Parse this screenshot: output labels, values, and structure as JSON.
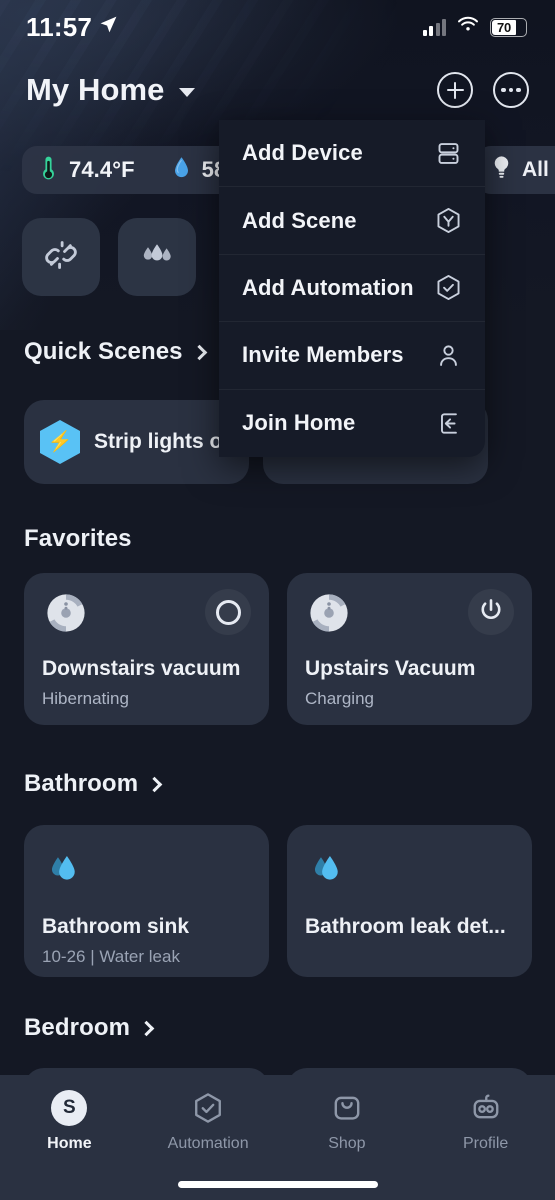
{
  "status_bar": {
    "time": "11:57",
    "location_icon": "location-arrow-icon",
    "cellular_icon": "cellular-bars-icon",
    "wifi_icon": "wifi-icon",
    "battery_percent": "70"
  },
  "header": {
    "title": "My Home",
    "dropdown_caret_icon": "chevron-down-icon",
    "add_button_icon": "plus-circle-icon",
    "more_button_icon": "more-circle-icon"
  },
  "sensor_pill": {
    "temperature": "74.4°F",
    "temperature_icon": "thermometer-icon",
    "temperature_color": "#35d39a",
    "humidity": "58",
    "humidity_icon": "water-drop-icon",
    "humidity_color": "#4aa3e8"
  },
  "quick_buttons": [
    {
      "name": "broken-link-icon",
      "label": ""
    },
    {
      "name": "water-drops-icon",
      "label": ""
    }
  ],
  "light_pill": {
    "label": "All o",
    "icon": "lightbulb-icon"
  },
  "menu": {
    "items": [
      {
        "label": "Add Device",
        "icon": "device-list-icon"
      },
      {
        "label": "Add Scene",
        "icon": "scene-hexagon-icon"
      },
      {
        "label": "Add Automation",
        "icon": "automation-check-icon"
      },
      {
        "label": "Invite Members",
        "icon": "person-icon"
      },
      {
        "label": "Join Home",
        "icon": "enter-door-icon"
      }
    ]
  },
  "sections": {
    "quick_scenes": {
      "title": "Quick Scenes",
      "chevron_icon": "chevron-right-icon",
      "cards": [
        {
          "name": "Strip lights of",
          "icon": "bolt-hexagon-icon",
          "accent": "#59c2f5"
        },
        {
          "name": "",
          "icon": "",
          "accent": "#59c2f5"
        }
      ]
    },
    "favorites": {
      "title": "Favorites",
      "cards": [
        {
          "name": "Downstairs vacuum",
          "status": "Hibernating",
          "device_icon": "robot-vacuum-icon",
          "toggle_icon": "circle-outline-icon"
        },
        {
          "name": "Upstairs Vacuum",
          "status": "Charging",
          "device_icon": "robot-vacuum-icon",
          "toggle_icon": "power-icon"
        }
      ]
    },
    "bathroom": {
      "title": "Bathroom",
      "chevron_icon": "chevron-right-icon",
      "cards": [
        {
          "name": "Bathroom sink",
          "status": "10-26 | Water leak",
          "device_icon": "water-leak-icon"
        },
        {
          "name": "Bathroom leak det...",
          "status": "",
          "device_icon": "water-leak-icon"
        }
      ]
    },
    "bedroom": {
      "title": "Bedroom",
      "chevron_icon": "chevron-right-icon",
      "cards": [
        {
          "name": "",
          "status": "",
          "device_icon": "robot-vacuum-icon"
        },
        {
          "name": "",
          "status": "",
          "device_icon": "scene-hexagon-icon"
        }
      ]
    }
  },
  "tabbar": {
    "items": [
      {
        "label": "Home",
        "icon": "smartthings-s-icon",
        "active": true
      },
      {
        "label": "Automation",
        "icon": "automation-check-icon",
        "active": false
      },
      {
        "label": "Shop",
        "icon": "shopping-bag-icon",
        "active": false
      },
      {
        "label": "Profile",
        "icon": "robot-face-icon",
        "active": false
      }
    ]
  }
}
